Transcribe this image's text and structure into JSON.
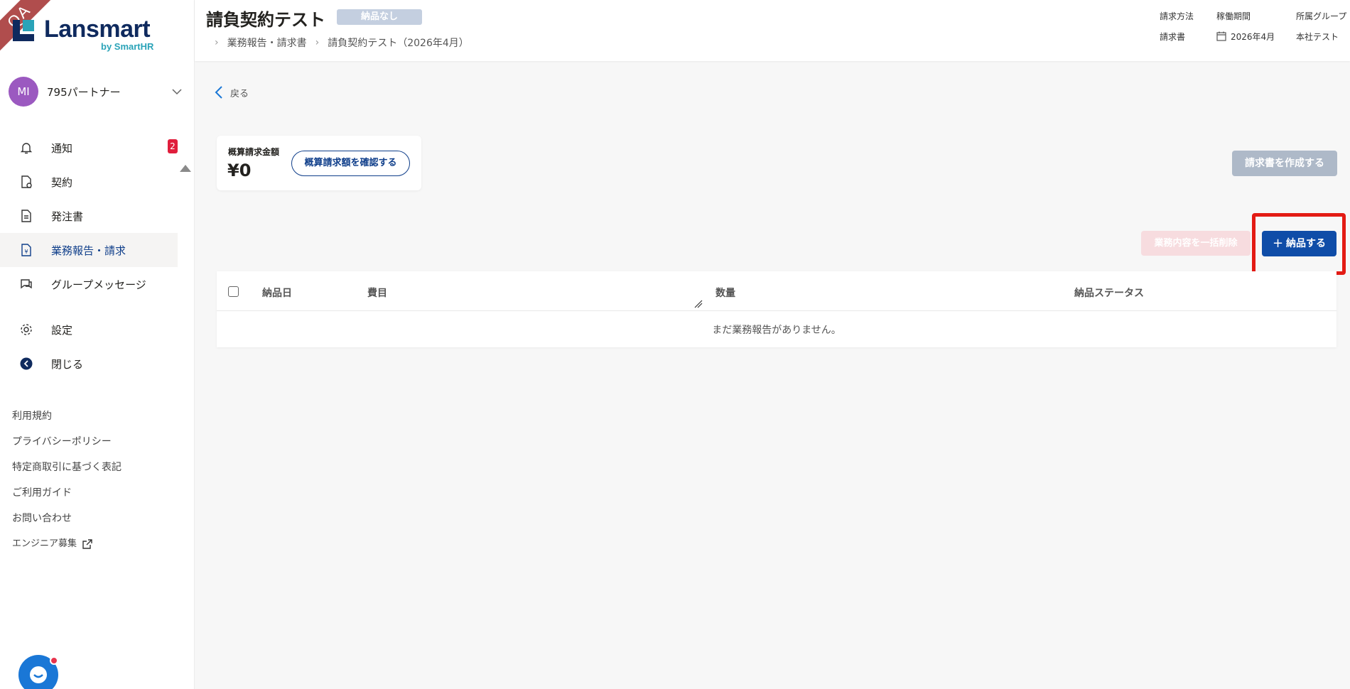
{
  "ribbon": {
    "text": "QA"
  },
  "logo": {
    "word": "Lansmart",
    "by": "by SmartHR"
  },
  "account": {
    "initials": "MI",
    "name": "795パートナー"
  },
  "nav": {
    "items": [
      {
        "label": "通知",
        "icon": "bell-icon",
        "badge": "2"
      },
      {
        "label": "契約",
        "icon": "contract-icon"
      },
      {
        "label": "発注書",
        "icon": "document-icon"
      },
      {
        "label": "業務報告・請求",
        "icon": "invoice-icon",
        "active": true
      },
      {
        "label": "グループメッセージ",
        "icon": "chat-icon"
      },
      {
        "label": "設定",
        "icon": "gear-icon"
      },
      {
        "label": "閉じる",
        "icon": "arrow-left-circle-icon"
      }
    ]
  },
  "footer": {
    "links": [
      "利用規約",
      "プライバシーポリシー",
      "特定商取引に基づく表記",
      "ご利用ガイド",
      "お問い合わせ",
      "エンジニア募集"
    ]
  },
  "header": {
    "title": "請負契約テスト",
    "status": "納品なし",
    "breadcrumb": [
      "業務報告・請求書",
      "請負契約テスト（2026年4月）"
    ],
    "meta": [
      {
        "label": "請求方法",
        "value": "請求書"
      },
      {
        "label": "稼働期間",
        "value": "2026年4月"
      },
      {
        "label": "所属グループ",
        "value": "本社テスト"
      }
    ]
  },
  "main": {
    "back": "戻る",
    "estimate": {
      "label": "概算請求金額",
      "amount": "¥0",
      "button": "概算請求額を確認する"
    },
    "create_invoice": "請求書を作成する",
    "bulk_delete": "業務内容を一括削除",
    "deliver": "納品する",
    "table": {
      "columns": [
        "納品日",
        "費目",
        "数量",
        "納品ステータス"
      ],
      "empty": "まだ業務報告がありません。"
    }
  },
  "colors": {
    "primary": "#0f4da8",
    "active_nav": "#0f3e8a",
    "badge_red": "#e01e3c",
    "highlight_red": "#e31b14",
    "avatar_purple": "#9b59c0"
  }
}
